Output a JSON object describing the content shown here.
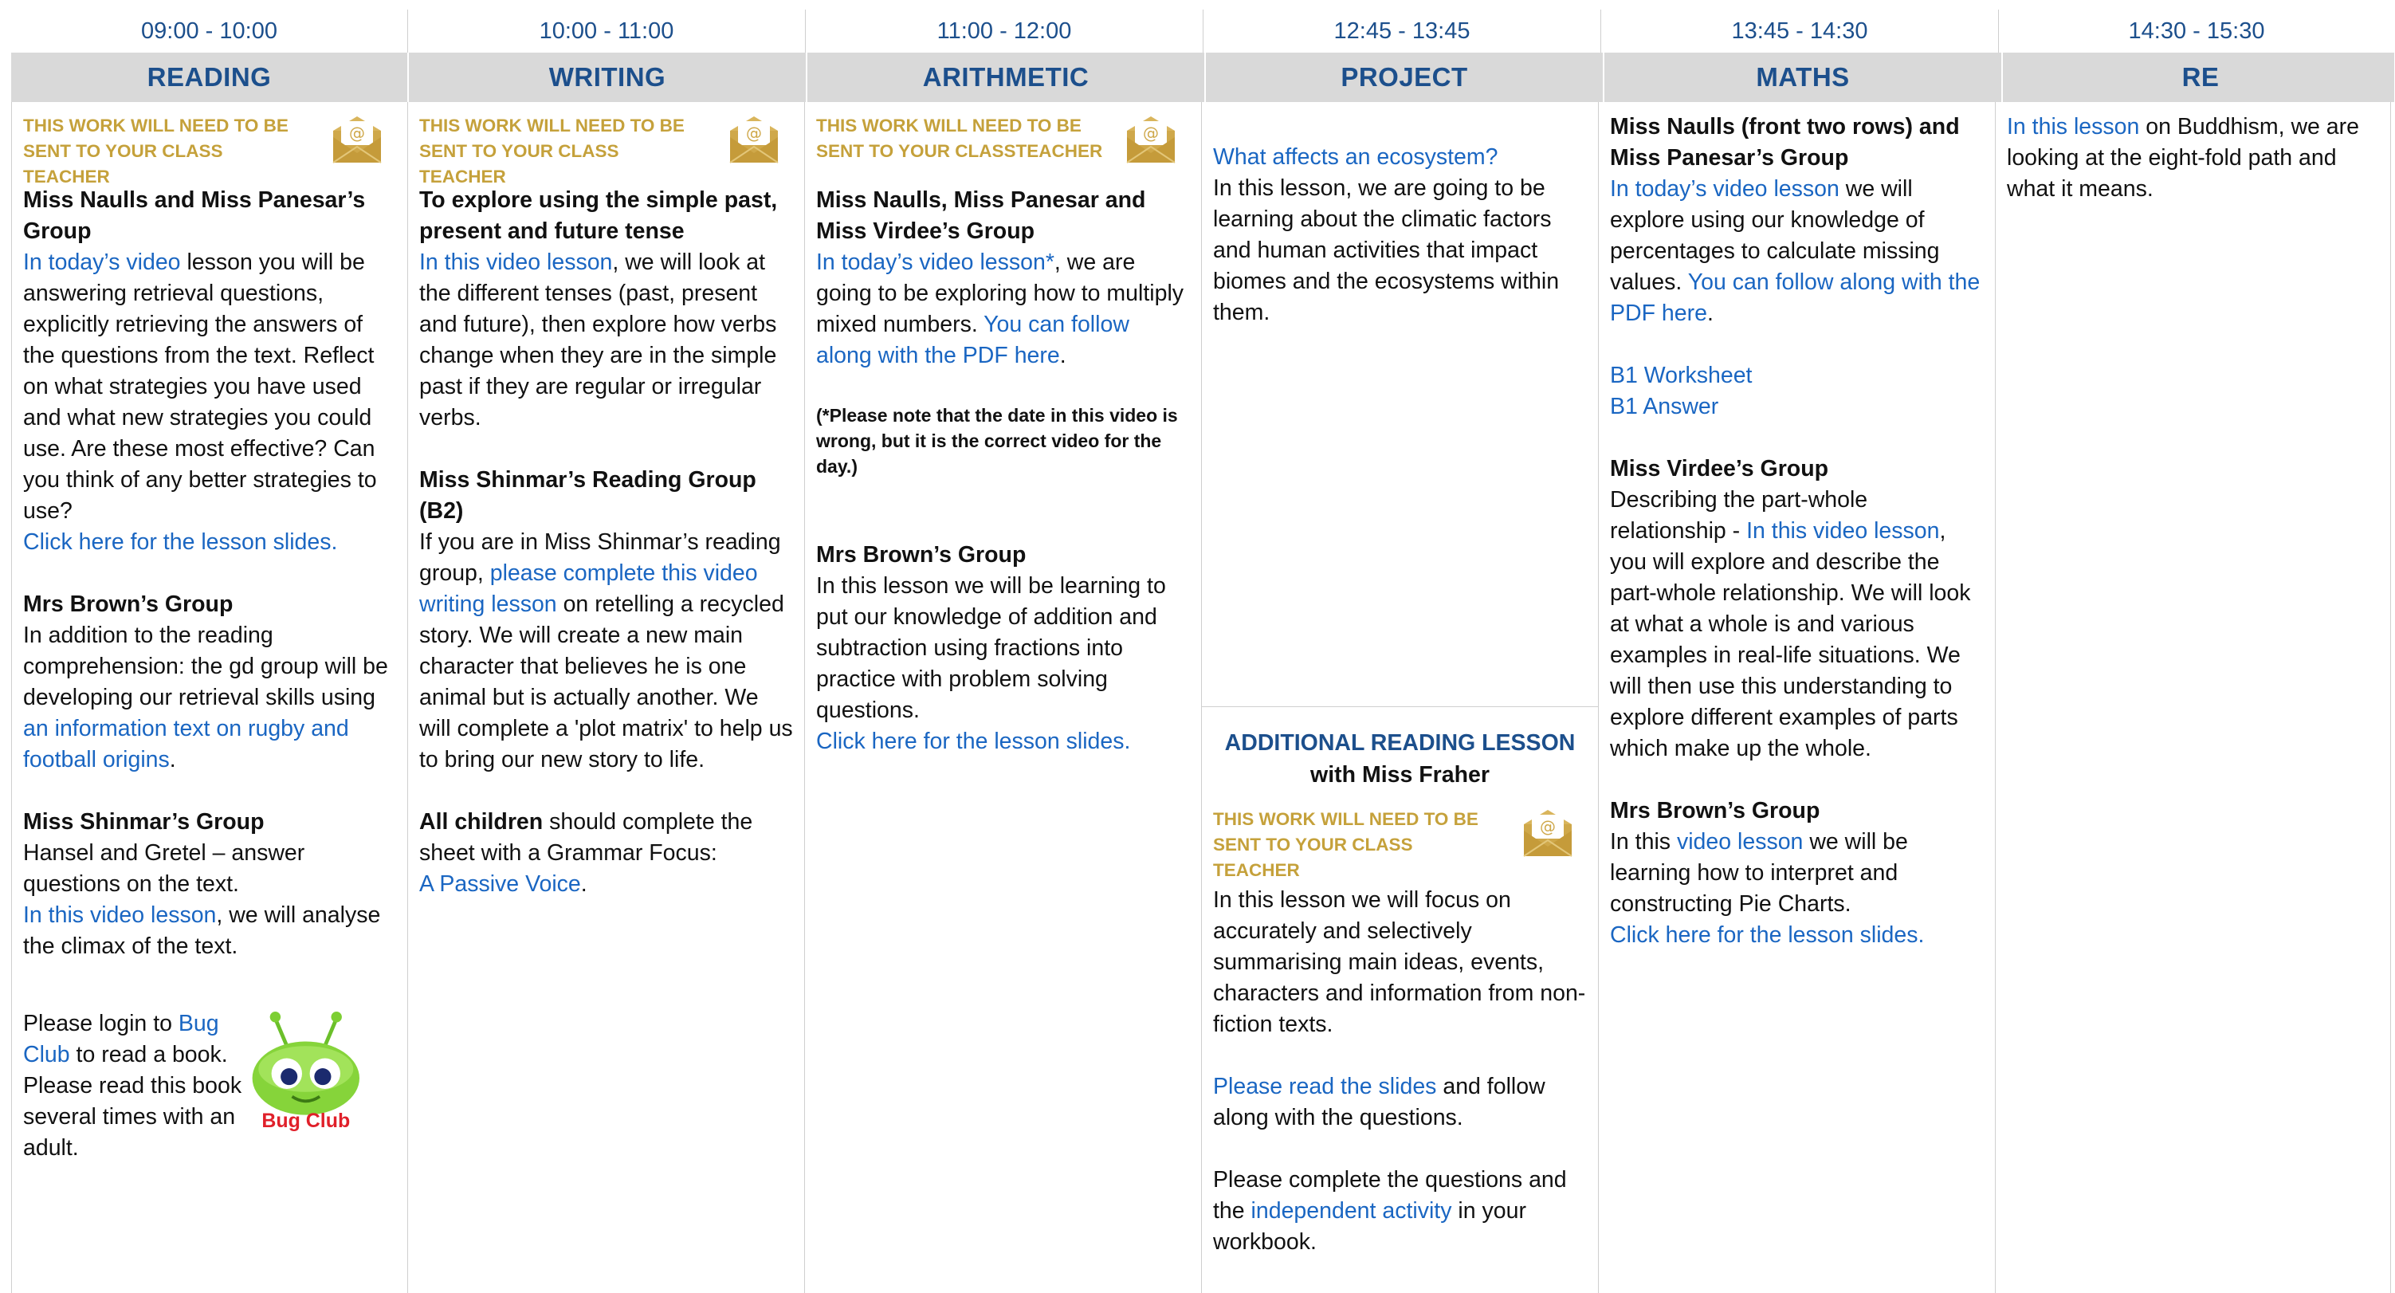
{
  "times": [
    "09:00 - 10:00",
    "10:00 - 11:00",
    "11:00 - 12:00",
    "12:45 - 13:45",
    "13:45 - 14:30",
    "14:30 - 15:30"
  ],
  "subjects": [
    "READING",
    "WRITING",
    "ARITHMETIC",
    "PROJECT",
    "MATHS",
    "RE"
  ],
  "colors": {
    "time_text": "#1c4f8c",
    "header_bg": "#d9d9d9",
    "notice_gold": "#c5a13b",
    "link_blue": "#1a66c2"
  },
  "icons": {
    "envelope": "envelope-icon",
    "bug_club": "bug-club-logo"
  },
  "notice": {
    "class_teacher": "THIS WORK WILL NEED TO BE SENT TO YOUR CLASS TEACHER",
    "classteacher": "THIS WORK WILL NEED TO BE SENT TO YOUR CLASSTEACHER"
  },
  "reading": {
    "g1_title": "Miss Naulls and Miss Panesar’s Group",
    "g1_link": "In today’s video",
    "g1_text": " lesson you will be answering retrieval questions, explicitly retrieving the answers of the questions from the text. Reflect on what strategies you have used and what new strategies you could use. Are these most effective? Can you think of any better strategies to use?",
    "g1_slides": "Click here for the lesson slides.",
    "g2_title": "Mrs Brown’s Group",
    "g2_text": "In addition to the reading comprehension: the gd group will be developing our retrieval skills using ",
    "g2_link": "an information text on rugby and football origins",
    "g2_end": ".",
    "g3_title": "Miss Shinmar’s Group",
    "g3_text": "Hansel and Gretel – answer questions on the text.",
    "g3_link": "In this video lesson",
    "g3_end": ", we will analyse the climax of the text.",
    "bug_a": "Please login to ",
    "bug_link": "Bug Club",
    "bug_b": " to read a book. Please read this book several times with an adult.",
    "bug_logo": "Bug Club"
  },
  "writing": {
    "title": "To explore using the simple past, present and future tense",
    "link1": "In this video lesson",
    "text1": ", we will look at the different tenses (past, present and future), then explore how verbs change when they are in the simple past if they are regular or irregular verbs.",
    "g2_title": "Miss Shinmar’s Reading Group (B2)",
    "g2_a": "If you are in Miss Shinmar’s reading group, ",
    "g2_link": "please complete this video writing lesson",
    "g2_b": " on retelling a recycled story. We will create a new main character that believes he is one animal but is actually another. We will complete a 'plot matrix' to help us to bring our new story to life.",
    "all_bold": "All children",
    "all_text": " should complete the sheet with a Grammar Focus:",
    "passive_link": "A Passive Voice",
    "passive_end": "."
  },
  "arithmetic": {
    "g1_title": "Miss Naulls, Miss Panesar and Miss Virdee’s Group",
    "g1_link": "In today’s video lesson*",
    "g1_text": ", we are going to be exploring how to multiply mixed numbers. ",
    "g1_pdf": "You can follow along with the PDF here",
    "g1_end": ".",
    "note": "(*Please note that the date in this video is wrong, but it is the correct video for the day.)",
    "g2_title": "Mrs Brown’s Group",
    "g2_text": "In this lesson we will be learning to put our knowledge of addition and subtraction using fractions into practice with problem solving questions.",
    "g2_slides": "Click here for the lesson slides."
  },
  "project": {
    "q_link": "What affects an ecosystem?",
    "text": "In this lesson, we are going to be learning about the climatic factors and human activities that impact biomes and the ecosystems within them.",
    "add_title": "ADDITIONAL READING LESSON",
    "add_sub": "with Miss Fraher",
    "add_text": "In this lesson we will focus on accurately and selectively summarising main ideas, events, characters and information from non-fiction texts.",
    "slides_link": "Please read the slides",
    "slides_text": " and follow along with the questions.",
    "complete_a": "Please complete the questions and the ",
    "complete_link": "independent activity",
    "complete_b": " in your workbook."
  },
  "maths": {
    "g1_title": "Miss Naulls (front two rows) and Miss Panesar’s Group",
    "g1_link": "In today’s video lesson",
    "g1_text": " we will explore using our knowledge of percentages to calculate missing values. ",
    "g1_pdf": "You can follow along with the PDF here",
    "g1_end": ".",
    "ws": "B1 Worksheet",
    "ans": "B1 Answer",
    "g2_title": "Miss Virdee’s Group",
    "g2_a": "Describing the part-whole relationship - ",
    "g2_link": "In this video lesson",
    "g2_b": ", you will explore and describe the part-whole relationship. We will look at what a whole is and various examples in real-life situations. We will then use this understanding to explore different examples of parts which make up the whole.",
    "g3_title": "Mrs Brown’s Group",
    "g3_a": "In this ",
    "g3_link": "video lesson",
    "g3_b": " we will be learning how to interpret and constructing Pie Charts.",
    "g3_slides": "Click here for the lesson slides."
  },
  "re": {
    "link": "In this lesson",
    "text": " on Buddhism, we are looking at the eight-fold path and what it means."
  }
}
